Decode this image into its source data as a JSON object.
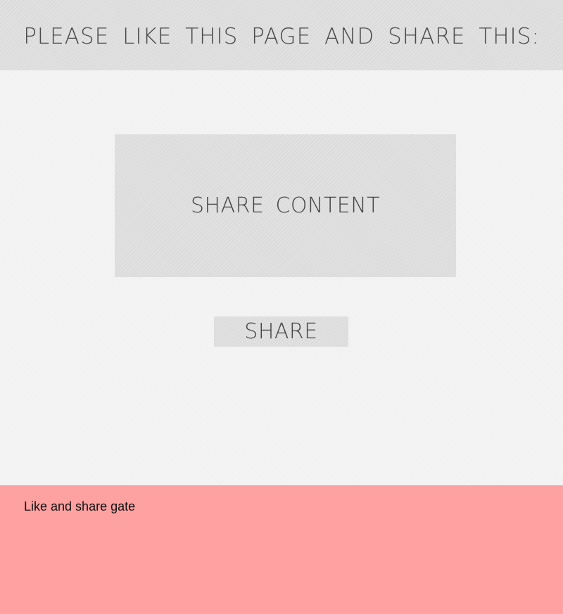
{
  "header": {
    "title": "PLEASE LIKE THIS PAGE AND SHARE THIS:"
  },
  "content": {
    "share_content_label": "SHARE CONTENT",
    "share_button_label": "SHARE"
  },
  "footer": {
    "caption": "Like and share gate"
  },
  "colors": {
    "footer_background": "#ffa1a1",
    "text": "#454545"
  }
}
